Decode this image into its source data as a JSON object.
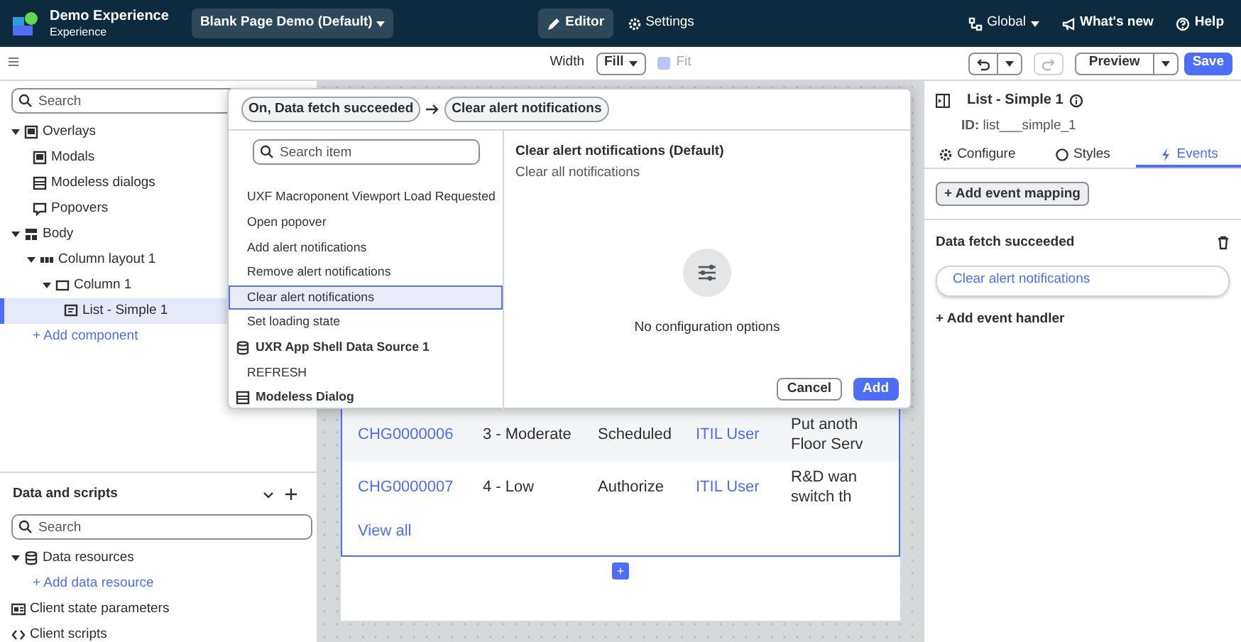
{
  "header": {
    "app_title": "Demo Experience",
    "app_subtitle": "Experience",
    "page_selector": "Blank Page Demo (Default)",
    "modes": [
      {
        "label": "Editor",
        "kind": "edit",
        "selected": true
      },
      {
        "label": "Settings",
        "kind": "settings",
        "selected": false
      }
    ],
    "scope": "Global",
    "links": [
      {
        "label": "What's new",
        "kind": "megaphone"
      },
      {
        "label": "Help",
        "kind": "help"
      }
    ]
  },
  "toolbar": {
    "width_label": "Width",
    "width_value": "Fill",
    "fit": {
      "label": "Fit",
      "checked": true,
      "disabled": true
    },
    "preview": "Preview",
    "save": "Save"
  },
  "layers": {
    "search_placeholder": "Search",
    "tree": [
      {
        "label": "Overlays",
        "kind": "overlay",
        "selected": false,
        "expanded": true,
        "children": [
          {
            "label": "Modals",
            "kind": "modal",
            "selected": false
          },
          {
            "label": "Modeless dialogs",
            "kind": "dialog",
            "selected": false
          },
          {
            "label": "Popovers",
            "kind": "popover",
            "selected": false
          }
        ]
      },
      {
        "label": "Body",
        "kind": "body",
        "selected": false,
        "expanded": true,
        "children": [
          {
            "label": "Column layout 1",
            "kind": "columns",
            "selected": false,
            "expanded": true,
            "children": [
              {
                "label": "Column 1",
                "kind": "column",
                "selected": false,
                "expanded": true,
                "children": [
                  {
                    "label": "List - Simple 1",
                    "kind": "list",
                    "selected": true
                  }
                ]
              }
            ]
          },
          {
            "label": "+ Add component",
            "kind": "add",
            "selected": false
          }
        ]
      }
    ]
  },
  "data_scripts": {
    "title": "Data and scripts",
    "search_placeholder": "Search",
    "tree": [
      {
        "label": "Data resources",
        "kind": "database",
        "selected": false,
        "expanded": true,
        "children": [
          {
            "label": "+ Add data resource",
            "kind": "add",
            "selected": false
          }
        ]
      },
      {
        "label": "Client state parameters",
        "kind": "params",
        "selected": false
      },
      {
        "label": "Client scripts",
        "kind": "script",
        "selected": false
      }
    ]
  },
  "canvas": {
    "rows": [
      {
        "number": "CHG0000006",
        "priority": "3 - Moderate",
        "state": "Scheduled",
        "assigned_to": "ITIL User",
        "description": [
          "Put anoth",
          "Floor Serv"
        ]
      },
      {
        "number": "CHG0000007",
        "priority": "4 - Low",
        "state": "Authorize",
        "assigned_to": "ITIL User",
        "description": [
          "R&D wan",
          "switch th"
        ]
      }
    ],
    "view_all": "View all",
    "add_button": "+"
  },
  "popover": {
    "breadcrumb": [
      "On, Data fetch succeeded",
      "Clear alert notifications"
    ],
    "search_placeholder": "Search item",
    "items": [
      {
        "label": "UXF Macroponent Viewport Load Requested",
        "kind": "action",
        "selected": false
      },
      {
        "label": "Open popover",
        "kind": "action",
        "selected": false
      },
      {
        "label": "Add alert notifications",
        "kind": "action",
        "selected": false
      },
      {
        "label": "Remove alert notifications",
        "kind": "action",
        "selected": false
      },
      {
        "label": "Clear alert notifications",
        "kind": "action",
        "selected": true
      },
      {
        "label": "Set loading state",
        "kind": "action",
        "selected": false
      },
      {
        "label": "UXR App Shell Data Source 1",
        "kind": "database",
        "selected": false
      },
      {
        "label": "REFRESH",
        "kind": "action",
        "selected": false
      },
      {
        "label": "Modeless Dialog",
        "kind": "dialog",
        "selected": false
      }
    ],
    "detail": {
      "title": "Clear alert notifications (Default)",
      "subtitle": "Clear all notifications",
      "empty_message": "No configuration options"
    },
    "buttons": [
      {
        "label": "Cancel",
        "kind": "secondary"
      },
      {
        "label": "Add",
        "kind": "primary"
      }
    ]
  },
  "properties": {
    "title": "List - Simple 1",
    "id_label": "ID:",
    "id_value": "list___simple_1",
    "tabs": [
      {
        "label": "Configure",
        "kind": "gear",
        "selected": false
      },
      {
        "label": "Styles",
        "kind": "styles",
        "selected": false
      },
      {
        "label": "Events",
        "kind": "bolt",
        "selected": true
      }
    ],
    "add_mapping": "+ Add event mapping",
    "mappings": [
      {
        "event": "Data fetch succeeded",
        "handlers": [
          "Clear alert notifications"
        ],
        "add_handler": "+ Add event handler"
      }
    ]
  }
}
